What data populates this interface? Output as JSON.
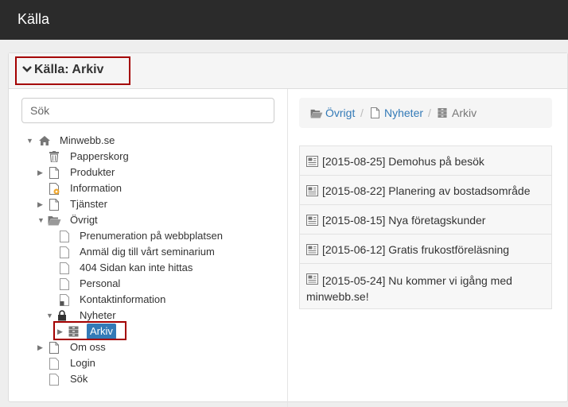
{
  "app": {
    "title": "Källa"
  },
  "panel": {
    "title": "Källa: Arkiv"
  },
  "search": {
    "placeholder": "Sök"
  },
  "tree": {
    "root": "Minwebb.se",
    "items": {
      "papperskorg": "Papperskorg",
      "produkter": "Produkter",
      "information": "Information",
      "tjanster": "Tjänster",
      "ovrigt": "Övrigt",
      "prenumeration": "Prenumeration på webbplatsen",
      "anmal": "Anmäl dig till vårt seminarium",
      "notfound": "404 Sidan kan inte hittas",
      "personal": "Personal",
      "kontakt": "Kontaktinformation",
      "nyheter": "Nyheter",
      "arkiv": "Arkiv",
      "omoss": "Om oss",
      "login": "Login",
      "sok": "Sök"
    }
  },
  "breadcrumb": {
    "items": [
      "Övrigt",
      "Nyheter",
      "Arkiv"
    ],
    "separator": "/"
  },
  "news": [
    "[2015-08-25] Demohus på besök",
    "[2015-08-22] Planering av bostadsområde",
    "[2015-08-15] Nya företagskunder",
    "[2015-06-12] Gratis frukostföreläsning",
    "[2015-05-24] Nu kommer vi igång med minwebb.se!"
  ],
  "colors": {
    "topbar": "#2b2b2b",
    "link": "#337ab7",
    "selected": "#337ab7",
    "highlight": "#a40000"
  }
}
